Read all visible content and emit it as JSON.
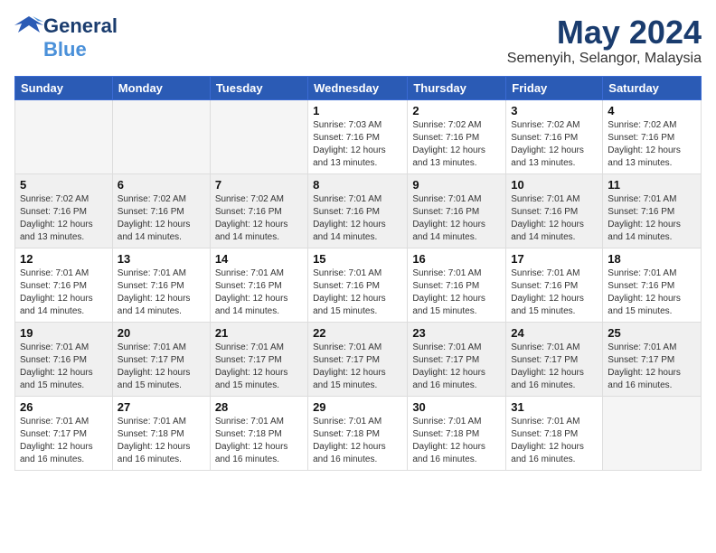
{
  "header": {
    "logo": {
      "general": "General",
      "blue": "Blue"
    },
    "month": "May 2024",
    "location": "Semenyih, Selangor, Malaysia"
  },
  "weekdays": [
    "Sunday",
    "Monday",
    "Tuesday",
    "Wednesday",
    "Thursday",
    "Friday",
    "Saturday"
  ],
  "weeks": [
    [
      {
        "day": "",
        "empty": true
      },
      {
        "day": "",
        "empty": true
      },
      {
        "day": "",
        "empty": true
      },
      {
        "day": "1",
        "sunrise": "7:03 AM",
        "sunset": "7:16 PM",
        "daylight": "12 hours and 13 minutes."
      },
      {
        "day": "2",
        "sunrise": "7:02 AM",
        "sunset": "7:16 PM",
        "daylight": "12 hours and 13 minutes."
      },
      {
        "day": "3",
        "sunrise": "7:02 AM",
        "sunset": "7:16 PM",
        "daylight": "12 hours and 13 minutes."
      },
      {
        "day": "4",
        "sunrise": "7:02 AM",
        "sunset": "7:16 PM",
        "daylight": "12 hours and 13 minutes."
      }
    ],
    [
      {
        "day": "5",
        "sunrise": "7:02 AM",
        "sunset": "7:16 PM",
        "daylight": "12 hours and 13 minutes."
      },
      {
        "day": "6",
        "sunrise": "7:02 AM",
        "sunset": "7:16 PM",
        "daylight": "12 hours and 14 minutes."
      },
      {
        "day": "7",
        "sunrise": "7:02 AM",
        "sunset": "7:16 PM",
        "daylight": "12 hours and 14 minutes."
      },
      {
        "day": "8",
        "sunrise": "7:01 AM",
        "sunset": "7:16 PM",
        "daylight": "12 hours and 14 minutes."
      },
      {
        "day": "9",
        "sunrise": "7:01 AM",
        "sunset": "7:16 PM",
        "daylight": "12 hours and 14 minutes."
      },
      {
        "day": "10",
        "sunrise": "7:01 AM",
        "sunset": "7:16 PM",
        "daylight": "12 hours and 14 minutes."
      },
      {
        "day": "11",
        "sunrise": "7:01 AM",
        "sunset": "7:16 PM",
        "daylight": "12 hours and 14 minutes."
      }
    ],
    [
      {
        "day": "12",
        "sunrise": "7:01 AM",
        "sunset": "7:16 PM",
        "daylight": "12 hours and 14 minutes."
      },
      {
        "day": "13",
        "sunrise": "7:01 AM",
        "sunset": "7:16 PM",
        "daylight": "12 hours and 14 minutes."
      },
      {
        "day": "14",
        "sunrise": "7:01 AM",
        "sunset": "7:16 PM",
        "daylight": "12 hours and 14 minutes."
      },
      {
        "day": "15",
        "sunrise": "7:01 AM",
        "sunset": "7:16 PM",
        "daylight": "12 hours and 15 minutes."
      },
      {
        "day": "16",
        "sunrise": "7:01 AM",
        "sunset": "7:16 PM",
        "daylight": "12 hours and 15 minutes."
      },
      {
        "day": "17",
        "sunrise": "7:01 AM",
        "sunset": "7:16 PM",
        "daylight": "12 hours and 15 minutes."
      },
      {
        "day": "18",
        "sunrise": "7:01 AM",
        "sunset": "7:16 PM",
        "daylight": "12 hours and 15 minutes."
      }
    ],
    [
      {
        "day": "19",
        "sunrise": "7:01 AM",
        "sunset": "7:16 PM",
        "daylight": "12 hours and 15 minutes."
      },
      {
        "day": "20",
        "sunrise": "7:01 AM",
        "sunset": "7:17 PM",
        "daylight": "12 hours and 15 minutes."
      },
      {
        "day": "21",
        "sunrise": "7:01 AM",
        "sunset": "7:17 PM",
        "daylight": "12 hours and 15 minutes."
      },
      {
        "day": "22",
        "sunrise": "7:01 AM",
        "sunset": "7:17 PM",
        "daylight": "12 hours and 15 minutes."
      },
      {
        "day": "23",
        "sunrise": "7:01 AM",
        "sunset": "7:17 PM",
        "daylight": "12 hours and 16 minutes."
      },
      {
        "day": "24",
        "sunrise": "7:01 AM",
        "sunset": "7:17 PM",
        "daylight": "12 hours and 16 minutes."
      },
      {
        "day": "25",
        "sunrise": "7:01 AM",
        "sunset": "7:17 PM",
        "daylight": "12 hours and 16 minutes."
      }
    ],
    [
      {
        "day": "26",
        "sunrise": "7:01 AM",
        "sunset": "7:17 PM",
        "daylight": "12 hours and 16 minutes."
      },
      {
        "day": "27",
        "sunrise": "7:01 AM",
        "sunset": "7:18 PM",
        "daylight": "12 hours and 16 minutes."
      },
      {
        "day": "28",
        "sunrise": "7:01 AM",
        "sunset": "7:18 PM",
        "daylight": "12 hours and 16 minutes."
      },
      {
        "day": "29",
        "sunrise": "7:01 AM",
        "sunset": "7:18 PM",
        "daylight": "12 hours and 16 minutes."
      },
      {
        "day": "30",
        "sunrise": "7:01 AM",
        "sunset": "7:18 PM",
        "daylight": "12 hours and 16 minutes."
      },
      {
        "day": "31",
        "sunrise": "7:01 AM",
        "sunset": "7:18 PM",
        "daylight": "12 hours and 16 minutes."
      },
      {
        "day": "",
        "empty": true
      }
    ]
  ]
}
